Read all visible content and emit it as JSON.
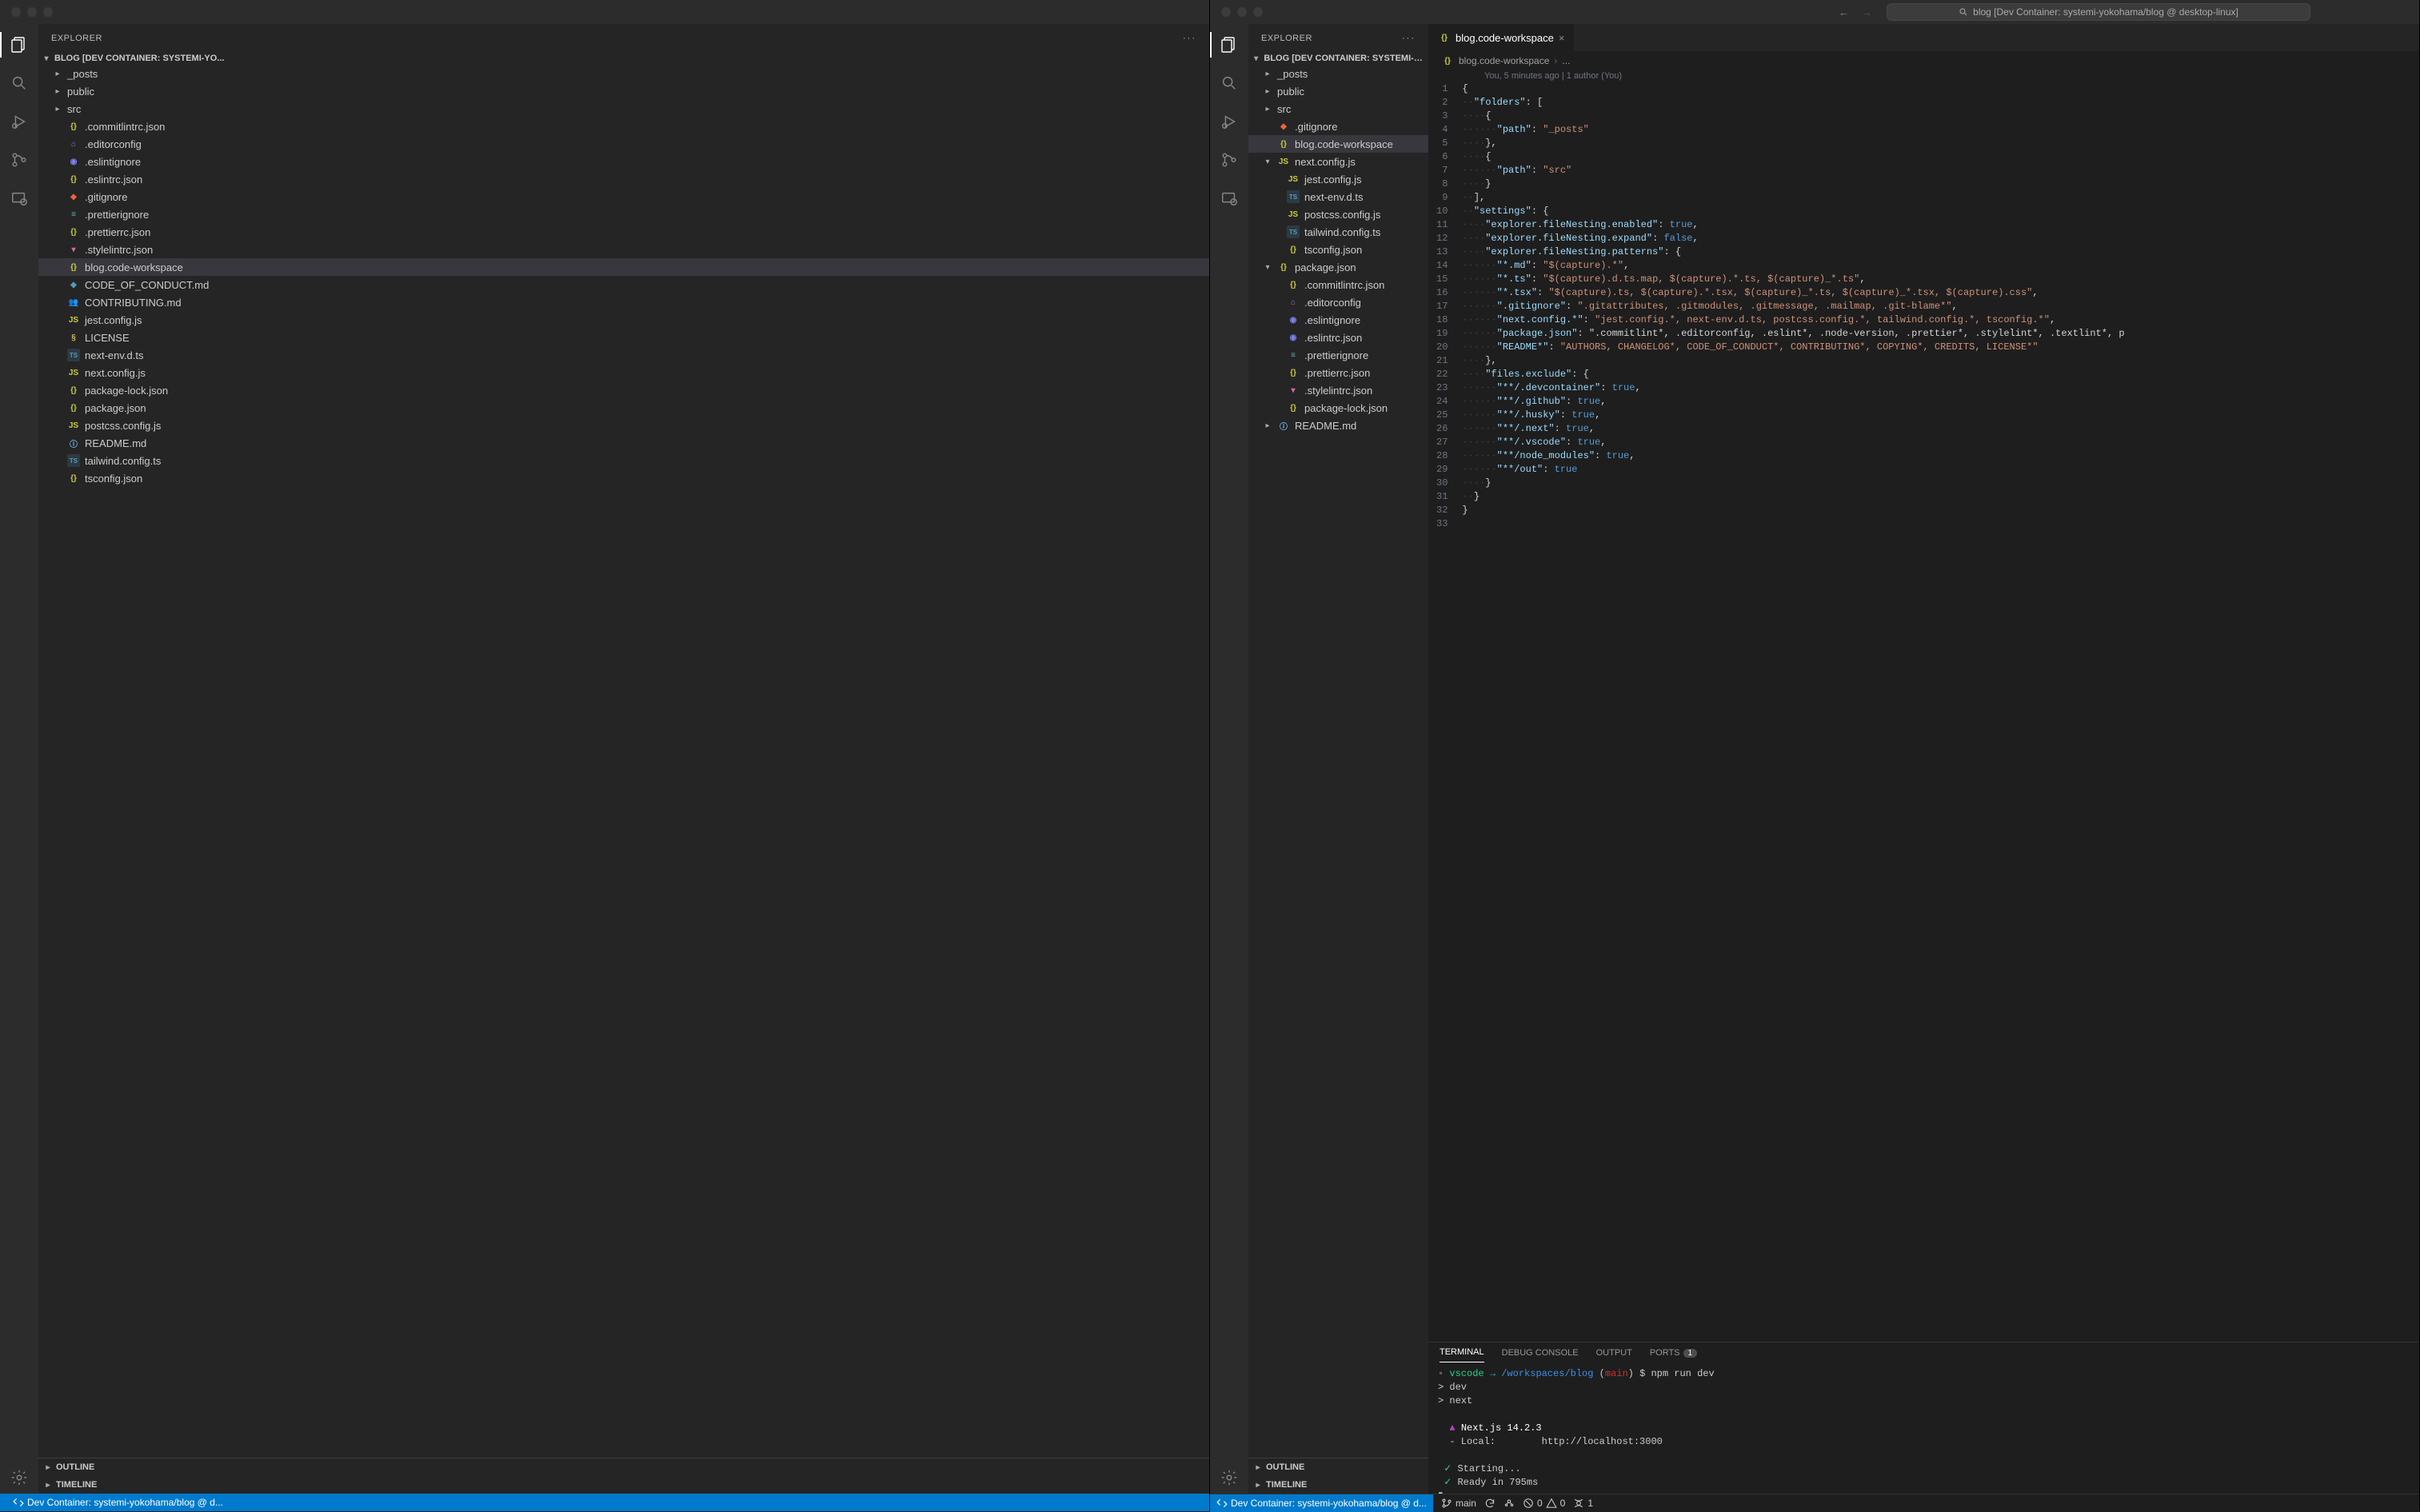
{
  "window1": {
    "explorer_title": "EXPLORER",
    "section_title": "BLOG [DEV CONTAINER: SYSTEMI-YO...",
    "tree": [
      {
        "type": "folder",
        "name": "_posts",
        "indent": 1
      },
      {
        "type": "folder",
        "name": "public",
        "indent": 1
      },
      {
        "type": "folder",
        "name": "src",
        "indent": 1
      },
      {
        "type": "file",
        "name": ".commitlintrc.json",
        "icon": "json",
        "indent": 1
      },
      {
        "type": "file",
        "name": ".editorconfig",
        "icon": "edit",
        "indent": 1
      },
      {
        "type": "file",
        "name": ".eslintignore",
        "icon": "eslint",
        "indent": 1
      },
      {
        "type": "file",
        "name": ".eslintrc.json",
        "icon": "json",
        "indent": 1
      },
      {
        "type": "file",
        "name": ".gitignore",
        "icon": "git",
        "indent": 1
      },
      {
        "type": "file",
        "name": ".prettierignore",
        "icon": "prettier",
        "indent": 1
      },
      {
        "type": "file",
        "name": ".prettierrc.json",
        "icon": "json",
        "indent": 1
      },
      {
        "type": "file",
        "name": ".stylelintrc.json",
        "icon": "style",
        "indent": 1
      },
      {
        "type": "file",
        "name": "blog.code-workspace",
        "icon": "json",
        "indent": 1,
        "selected": true
      },
      {
        "type": "file",
        "name": "CODE_OF_CONDUCT.md",
        "icon": "md",
        "indent": 1
      },
      {
        "type": "file",
        "name": "CONTRIBUTING.md",
        "icon": "people",
        "indent": 1
      },
      {
        "type": "file",
        "name": "jest.config.js",
        "icon": "js",
        "indent": 1
      },
      {
        "type": "file",
        "name": "LICENSE",
        "icon": "lic",
        "indent": 1
      },
      {
        "type": "file",
        "name": "next-env.d.ts",
        "icon": "ts",
        "indent": 1
      },
      {
        "type": "file",
        "name": "next.config.js",
        "icon": "js",
        "indent": 1
      },
      {
        "type": "file",
        "name": "package-lock.json",
        "icon": "json",
        "indent": 1
      },
      {
        "type": "file",
        "name": "package.json",
        "icon": "json",
        "indent": 1
      },
      {
        "type": "file",
        "name": "postcss.config.js",
        "icon": "js",
        "indent": 1
      },
      {
        "type": "file",
        "name": "README.md",
        "icon": "info",
        "indent": 1
      },
      {
        "type": "file",
        "name": "tailwind.config.ts",
        "icon": "ts",
        "indent": 1
      },
      {
        "type": "file",
        "name": "tsconfig.json",
        "icon": "json",
        "indent": 1
      }
    ],
    "outline": "OUTLINE",
    "timeline": "TIMELINE",
    "status": "Dev Container: systemi-yokohama/blog @ d..."
  },
  "window2": {
    "search_text": "blog [Dev Container: systemi-yokohama/blog @ desktop-linux]",
    "explorer_title": "EXPLORER",
    "section_title": "BLOG [DEV CONTAINER: SYSTEMI-YO...",
    "tree": [
      {
        "type": "folder",
        "name": "_posts",
        "indent": 1
      },
      {
        "type": "folder",
        "name": "public",
        "indent": 1
      },
      {
        "type": "folder",
        "name": "src",
        "indent": 1
      },
      {
        "type": "file",
        "name": ".gitignore",
        "icon": "git",
        "indent": 1
      },
      {
        "type": "file",
        "name": "blog.code-workspace",
        "icon": "json",
        "indent": 1,
        "selected": true
      },
      {
        "type": "file",
        "name": "next.config.js",
        "icon": "js",
        "indent": 1,
        "expanded": true
      },
      {
        "type": "file",
        "name": "jest.config.js",
        "icon": "js",
        "indent": 2
      },
      {
        "type": "file",
        "name": "next-env.d.ts",
        "icon": "ts",
        "indent": 2
      },
      {
        "type": "file",
        "name": "postcss.config.js",
        "icon": "js",
        "indent": 2
      },
      {
        "type": "file",
        "name": "tailwind.config.ts",
        "icon": "ts",
        "indent": 2
      },
      {
        "type": "file",
        "name": "tsconfig.json",
        "icon": "json",
        "indent": 2
      },
      {
        "type": "file",
        "name": "package.json",
        "icon": "json",
        "indent": 1,
        "expanded": true
      },
      {
        "type": "file",
        "name": ".commitlintrc.json",
        "icon": "json",
        "indent": 2
      },
      {
        "type": "file",
        "name": ".editorconfig",
        "icon": "edit",
        "indent": 2
      },
      {
        "type": "file",
        "name": ".eslintignore",
        "icon": "eslint",
        "indent": 2
      },
      {
        "type": "file",
        "name": ".eslintrc.json",
        "icon": "eslint",
        "indent": 2
      },
      {
        "type": "file",
        "name": ".prettierignore",
        "icon": "prettier",
        "indent": 2
      },
      {
        "type": "file",
        "name": ".prettierrc.json",
        "icon": "json",
        "indent": 2
      },
      {
        "type": "file",
        "name": ".stylelintrc.json",
        "icon": "style",
        "indent": 2
      },
      {
        "type": "file",
        "name": "package-lock.json",
        "icon": "json",
        "indent": 2
      },
      {
        "type": "folder",
        "name": "README.md",
        "icon": "info",
        "indent": 1
      }
    ],
    "outline": "OUTLINE",
    "timeline": "TIMELINE",
    "tab_name": "blog.code-workspace",
    "breadcrumb": "blog.code-workspace",
    "breadcrumb2": "...",
    "lens": "You, 5 minutes ago | 1 author (You)",
    "code_lines": [
      "{",
      "  \"folders\": [",
      "    {",
      "      \"path\": \"_posts\"",
      "    },",
      "    {",
      "      \"path\": \"src\"",
      "    }",
      "  ],",
      "  \"settings\": {",
      "    \"explorer.fileNesting.enabled\": true,",
      "    \"explorer.fileNesting.expand\": false,",
      "    \"explorer.fileNesting.patterns\": {",
      "      \"*.md\": \"$(capture).*\",",
      "      \"*.ts\": \"$(capture).d.ts.map, $(capture).*.ts, $(capture)_*.ts\",",
      "      \"*.tsx\": \"$(capture).ts, $(capture).*.tsx, $(capture)_*.ts, $(capture)_*.tsx, $(capture).css\",",
      "      \".gitignore\": \".gitattributes, .gitmodules, .gitmessage, .mailmap, .git-blame*\",",
      "      \"next.config.*\": \"jest.config.*, next-env.d.ts, postcss.config.*, tailwind.config.*, tsconfig.*\",",
      "      \"package.json\": \".commitlint*, .editorconfig, .eslint*, .node-version, .prettier*, .stylelint*, .textlint*, p",
      "      \"README*\": \"AUTHORS, CHANGELOG*, CODE_OF_CONDUCT*, CONTRIBUTING*, COPYING*, CREDITS, LICENSE*\"",
      "    },",
      "    \"files.exclude\": {",
      "      \"**/.devcontainer\": true,",
      "      \"**/.github\": true,",
      "      \"**/.husky\": true,",
      "      \"**/.next\": true,",
      "      \"**/.vscode\": true,",
      "      \"**/node_modules\": true,",
      "      \"**/out\": true",
      "    }",
      "  }",
      "}",
      ""
    ],
    "panel": {
      "tabs": [
        "TERMINAL",
        "DEBUG CONSOLE",
        "OUTPUT",
        "PORTS"
      ],
      "ports_badge": "1",
      "prompt_user": "vscode",
      "prompt_arrow": "→",
      "prompt_path": "/workspaces/blog",
      "prompt_branch": "main",
      "prompt_cmd": "npm run dev",
      "out": [
        "> dev",
        "> next",
        "",
        "  ▲ Next.js 14.2.3",
        "  - Local:        http://localhost:3000",
        "",
        " ✓ Starting...",
        " ✓ Ready in 795ms"
      ]
    },
    "status": {
      "remote": "Dev Container: systemi-yokohama/blog @ d...",
      "branch": "main",
      "errors": "0",
      "warnings": "0",
      "ports": "1"
    }
  }
}
